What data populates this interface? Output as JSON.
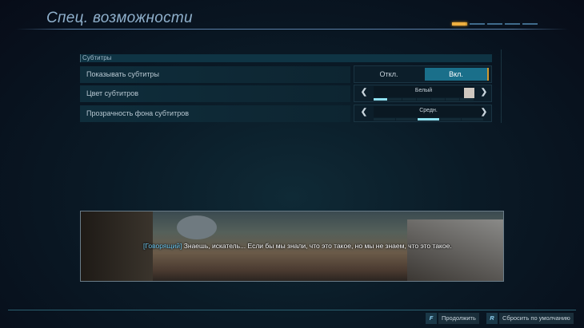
{
  "header": {
    "title": "Спец. возможности",
    "pages": 5,
    "active_page": 1
  },
  "section": {
    "title": "Субтитры"
  },
  "settings": [
    {
      "label": "Показывать субтитры",
      "type": "toggle",
      "off_label": "Откл.",
      "on_label": "Вкл.",
      "value": "Вкл."
    },
    {
      "label": "Цвет субтитров",
      "type": "selector",
      "value": "Белый",
      "swatch_color": "#cfc8c0",
      "position": 1,
      "count": 7
    },
    {
      "label": "Прозрачность фона субтитров",
      "type": "selector",
      "value": "Средн.",
      "position": 3,
      "count": 5
    }
  ],
  "preview": {
    "speaker": "[Говорящий]",
    "text": "Знаешь, искатель... Если бы мы знали, что это такое, но мы не знаем, что это такое."
  },
  "footer": {
    "continue_key": "F",
    "continue_label": "Продолжить",
    "reset_key": "R",
    "reset_label": "Сбросить по умолчанию"
  }
}
